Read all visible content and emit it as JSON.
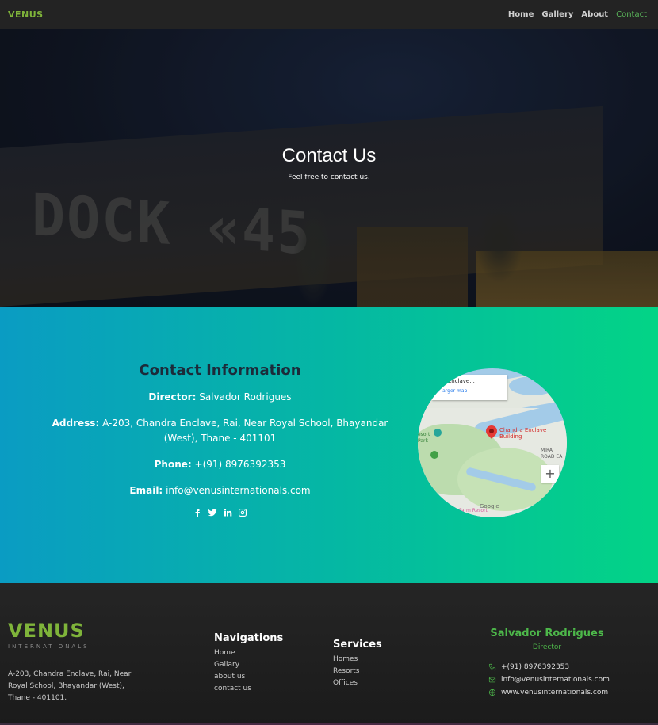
{
  "nav": {
    "logo_text": "VENUS",
    "links": [
      "Home",
      "Gallery",
      "About",
      "Contact"
    ],
    "active": "Contact"
  },
  "hero": {
    "title": "Contact Us",
    "subtitle": "Feel free to contact us.",
    "background_sign": "DOCK «45"
  },
  "contact": {
    "heading": "Contact Information",
    "director_label": "Director:",
    "director_value": "Salvador Rodrigues",
    "address_label": "Address:",
    "address_value": "A-203, Chandra Enclave, Rai, Near Royal School, Bhayandar (West), Thane - 401101",
    "phone_label": "Phone:",
    "phone_value": "+(91) 8976392353",
    "email_label": "Email:",
    "email_value": "info@venusinternationals.com",
    "socials": [
      "facebook-icon",
      "twitter-icon",
      "linkedin-icon",
      "instagram-icon"
    ]
  },
  "map": {
    "card_title": "dra Enclave...",
    "card_link": "v larger map",
    "pin_label_line1": "Chandra Enclave",
    "pin_label_line2": "Building",
    "area_label_line1": "MIRA",
    "area_label_line2": "ROAD EA",
    "zoom_label": "+",
    "google_label": "Google",
    "farm_label": "Farm Resort",
    "left_label_line1": "esort",
    "left_label_line2": "Park"
  },
  "footer": {
    "logo_text": "VENUS",
    "logo_sub": "INTERNATIONALS",
    "address": "A-203, Chandra Enclave, Rai, Near Royal School, Bhayandar (West), Thane - 401101.",
    "nav_heading": "Navigations",
    "nav_links": [
      "Home",
      "Gallary",
      "about us",
      "contact us"
    ],
    "services_heading": "Services",
    "services": [
      "Homes",
      "Resorts",
      "Offices"
    ],
    "card_name": "Salvador Rodrigues",
    "card_role": "Director",
    "card_phone": "+(91) 8976392353",
    "card_email": "info@venusinternationals.com",
    "card_web": "www.venusinternationals.com"
  },
  "colors": {
    "accent": "#4db84a",
    "contact_gradient_start": "#0a9cc3",
    "contact_gradient_end": "#03d486",
    "nav_bg": "#232323",
    "footer_bg": "#1e1e1e"
  }
}
